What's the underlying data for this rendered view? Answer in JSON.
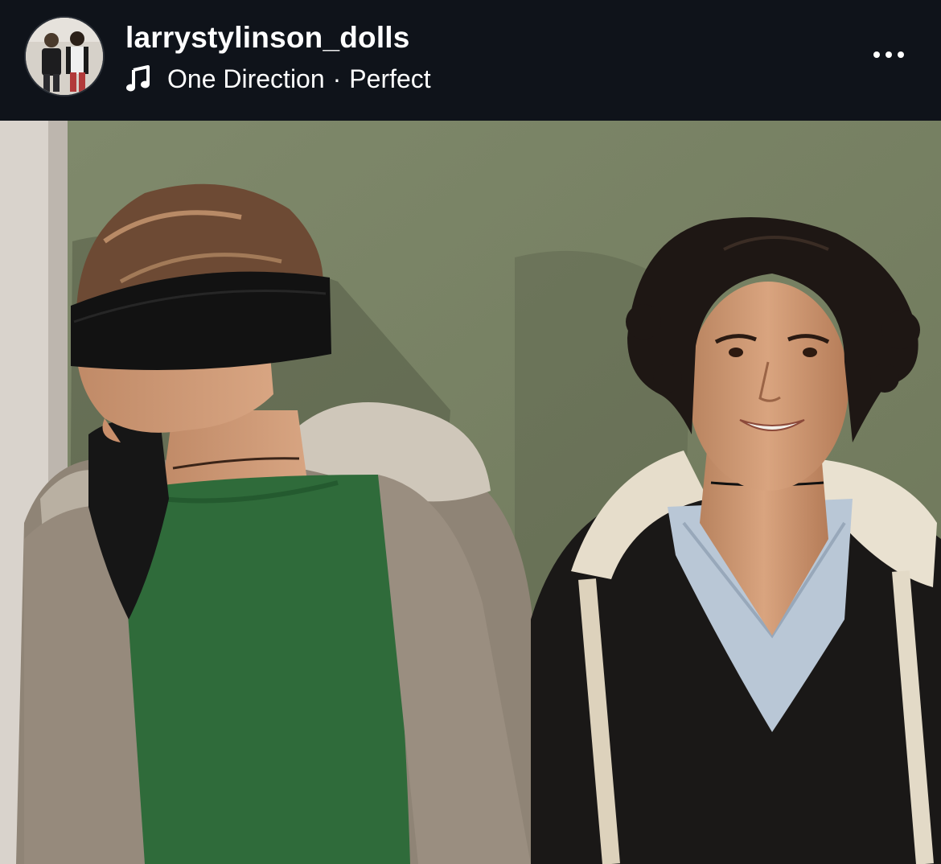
{
  "post": {
    "username": "larrystylinson_dolls",
    "music": {
      "artist": "One Direction",
      "separator": "·",
      "song": "Perfect",
      "icon": "music-note-icon"
    },
    "more_icon": "more-options-icon",
    "avatar_icon": "profile-avatar-icon"
  },
  "colors": {
    "header_bg": "#0f131a",
    "text": "#ffffff",
    "wall": "#7b8466",
    "sweater": "#2f6b3a",
    "cardigan": "#8f8476",
    "jacket": "#1a1817"
  }
}
